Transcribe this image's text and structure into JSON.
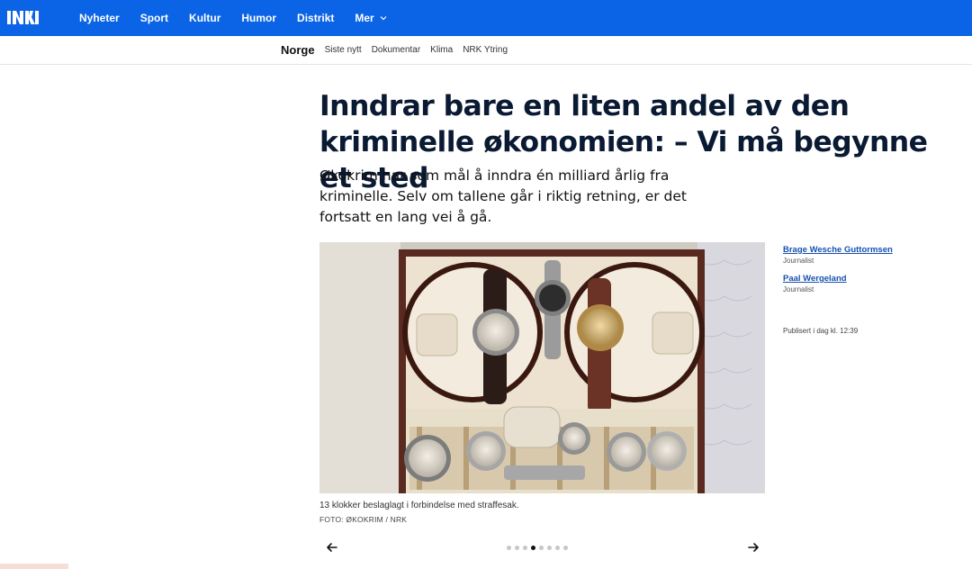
{
  "brand": {
    "logo": "NRK",
    "accent": "#0b63e5"
  },
  "mainnav": {
    "items": [
      "Nyheter",
      "Sport",
      "Kultur",
      "Humor",
      "Distrikt",
      "Mer"
    ]
  },
  "subnav": {
    "section": "Norge",
    "links": [
      "Siste nytt",
      "Dokumentar",
      "Klima",
      "NRK Ytring"
    ]
  },
  "article": {
    "title": "Inndrar bare en liten andel av den kriminelle økonomien: – Vi må begynne et sted",
    "lead": "Økokrim har som mål å inndra én milliard årlig fra kriminelle. Selv om tallene går i riktig retning, er det fortsatt en lang vei å gå.",
    "image_caption": "13 klokker beslaglagt i forbindelse med straffesak.",
    "image_credit": "FOTO: ØKOKRIM / NRK"
  },
  "byline": {
    "authors": [
      {
        "name": "Brage Wesche Guttormsen",
        "role": "Journalist"
      },
      {
        "name": "Paal Wergeland",
        "role": "Journalist"
      }
    ],
    "published": "Publisert i dag kl. 12:39"
  },
  "carousel": {
    "count": 8,
    "active_index": 4
  },
  "icons": {
    "prev": "arrow-left-icon",
    "next": "arrow-right-icon",
    "more": "chevron-down-icon"
  }
}
